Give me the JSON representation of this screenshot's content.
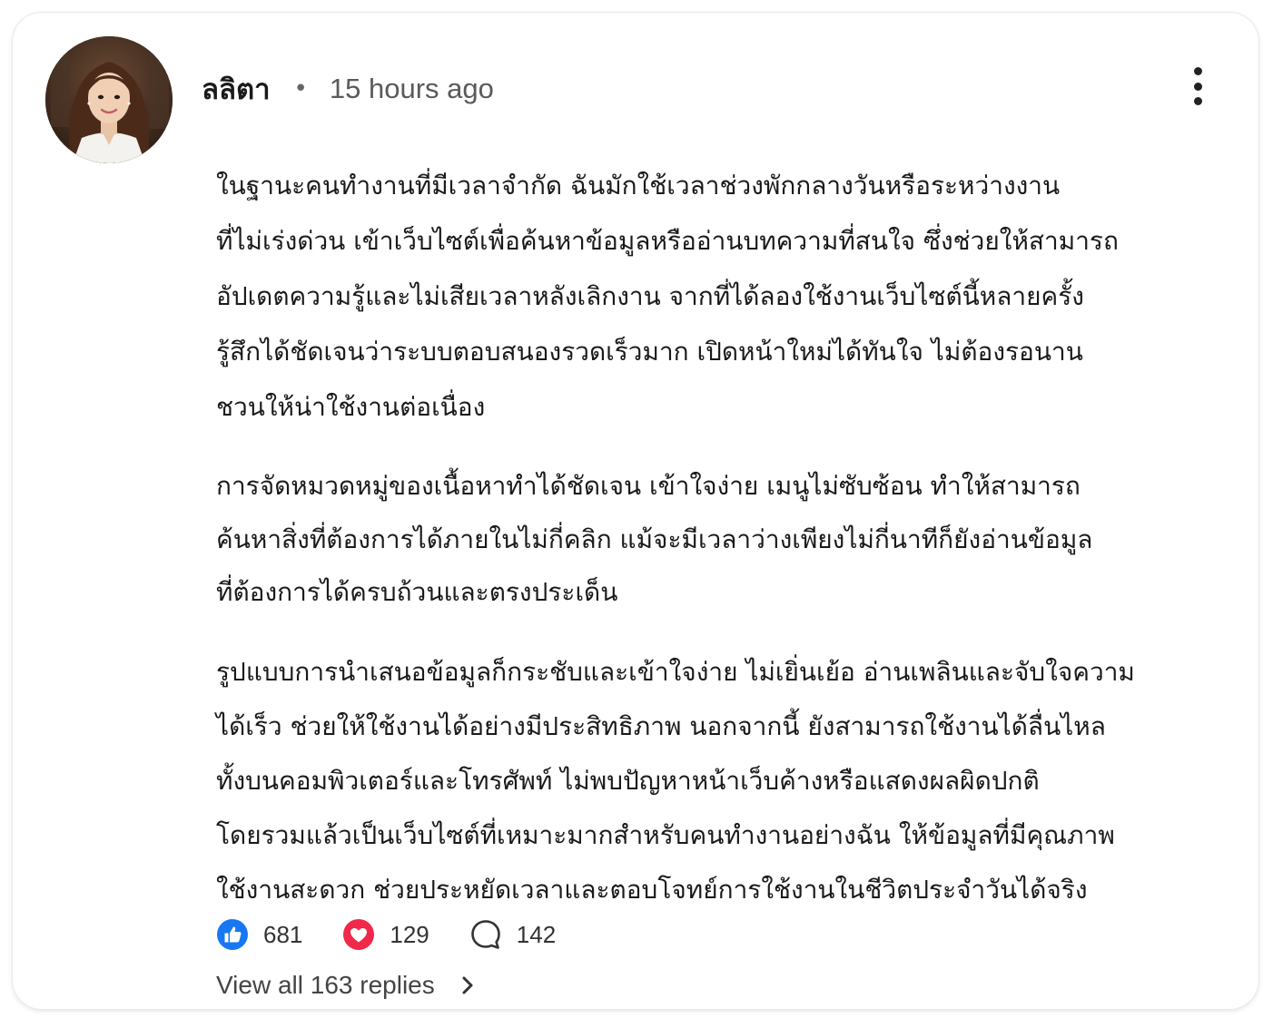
{
  "comment": {
    "username": "ลลิตา",
    "separator": "•",
    "timestamp": "15 hours ago",
    "more_icon": "more-vertical-icon",
    "avatar_icon": "profile-photo-woman",
    "paragraphs": [
      {
        "lines": [
          "ในฐานะคนทำงานที่มีเวลาจำกัด ฉันมักใช้เวลาช่วงพักกลางวันหรือระหว่างงาน",
          "ที่ไม่เร่งด่วน เข้าเว็บไซต์เพื่อค้นหาข้อมูลหรืออ่านบทความที่สนใจ ซึ่งช่วยให้สามารถ",
          "อัปเดตความรู้และไม่เสียเวลาหลังเลิกงาน จากที่ได้ลองใช้งานเว็บไซต์นี้หลายครั้ง",
          "รู้สึกได้ชัดเจนว่าระบบตอบสนองรวดเร็วมาก เปิดหน้าใหม่ได้ทันใจ ไม่ต้องรอนาน",
          "ชวนให้น่าใช้งานต่อเนื่อง"
        ]
      },
      {
        "lines": [
          "การจัดหมวดหมู่ของเนื้อหาทำได้ชัดเจน เข้าใจง่าย เมนูไม่ซับซ้อน ทำให้สามารถ",
          "ค้นหาสิ่งที่ต้องการได้ภายในไม่กี่คลิก แม้จะมีเวลาว่างเพียงไม่กี่นาทีก็ยังอ่านข้อมูล",
          "ที่ต้องการได้ครบถ้วนและตรงประเด็น"
        ]
      },
      {
        "lines": [
          "รูปแบบการนำเสนอข้อมูลก็กระชับและเข้าใจง่าย ไม่เยิ่นเย้อ อ่านเพลินและจับใจความ",
          "ได้เร็ว ช่วยให้ใช้งานได้อย่างมีประสิทธิภาพ นอกจากนี้ ยังสามารถใช้งานได้ลื่นไหล",
          "ทั้งบนคอมพิวเตอร์และโทรศัพท์ ไม่พบปัญหาหน้าเว็บค้างหรือแสดงผลผิดปกติ",
          "โดยรวมแล้วเป็นเว็บไซต์ที่เหมาะมากสำหรับคนทำงานอย่างฉัน ให้ข้อมูลที่มีคุณภาพ",
          "ใช้งานสะดวก ช่วยประหยัดเวลาและตอบโจทย์การใช้งานในชีวิตประจำวันได้จริง"
        ]
      }
    ],
    "reactions": {
      "like": {
        "icon": "thumbs-up-icon",
        "count": "681",
        "color": "#1877F2"
      },
      "love": {
        "icon": "heart-icon",
        "count": "129",
        "color": "#F02849"
      },
      "comment": {
        "icon": "comment-bubble-icon",
        "count": "142",
        "color": "#333333"
      }
    },
    "replies_link": {
      "label": "View all 163 replies",
      "icon": "chevron-right-icon"
    }
  }
}
